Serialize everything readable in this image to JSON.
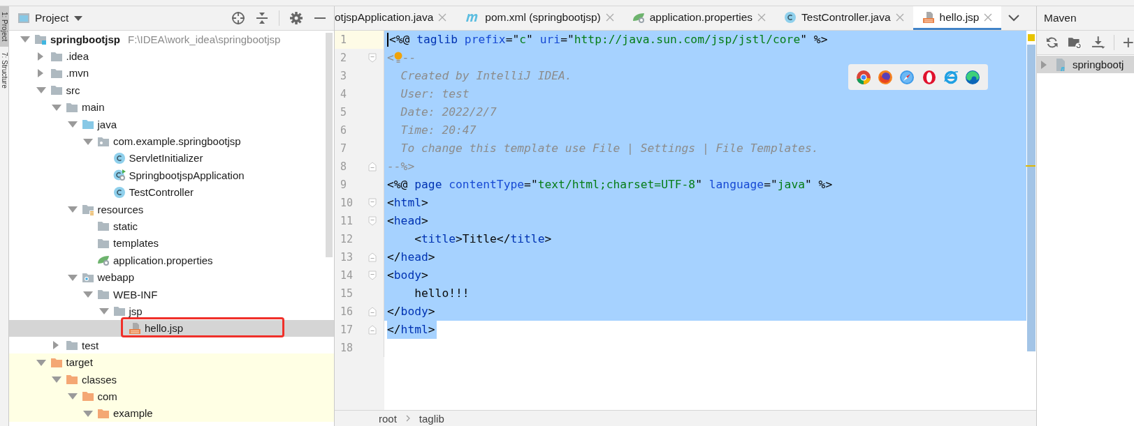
{
  "tool_strip": [
    {
      "label": "1: Project",
      "selected": true
    },
    {
      "label": "7: Structure",
      "selected": false
    }
  ],
  "project_panel": {
    "title": "Project",
    "tree": [
      {
        "label": "springbootjsp",
        "path": "F:\\IDEA\\work_idea\\springbootjsp",
        "kind": "module",
        "expanded": true,
        "selected": false,
        "excluded": false,
        "children": [
          {
            "label": ".idea",
            "kind": "folder",
            "expanded": false,
            "selected": false,
            "excluded": false
          },
          {
            "label": ".mvn",
            "kind": "folder",
            "expanded": false,
            "selected": false,
            "excluded": false
          },
          {
            "label": "src",
            "kind": "folder",
            "expanded": true,
            "selected": false,
            "excluded": false,
            "children": [
              {
                "label": "main",
                "kind": "folder",
                "expanded": true,
                "selected": false,
                "excluded": false,
                "children": [
                  {
                    "label": "java",
                    "kind": "source",
                    "expanded": true,
                    "selected": false,
                    "excluded": false,
                    "children": [
                      {
                        "label": "com.example.springbootjsp",
                        "kind": "package",
                        "expanded": true,
                        "selected": false,
                        "excluded": false,
                        "children": [
                          {
                            "label": "ServletInitializer",
                            "kind": "class",
                            "selected": false,
                            "excluded": false
                          },
                          {
                            "label": "SpringbootjspApplication",
                            "kind": "spring-class",
                            "selected": false,
                            "excluded": false
                          },
                          {
                            "label": "TestController",
                            "kind": "class",
                            "selected": false,
                            "excluded": false
                          }
                        ]
                      }
                    ]
                  },
                  {
                    "label": "resources",
                    "kind": "resources",
                    "expanded": true,
                    "selected": false,
                    "excluded": false,
                    "children": [
                      {
                        "label": "static",
                        "kind": "folder",
                        "selected": false,
                        "excluded": false
                      },
                      {
                        "label": "templates",
                        "kind": "folder",
                        "selected": false,
                        "excluded": false
                      },
                      {
                        "label": "application.properties",
                        "kind": "properties",
                        "selected": false,
                        "excluded": false
                      }
                    ]
                  },
                  {
                    "label": "webapp",
                    "kind": "webapp",
                    "expanded": true,
                    "selected": false,
                    "excluded": false,
                    "children": [
                      {
                        "label": "WEB-INF",
                        "kind": "folder",
                        "expanded": true,
                        "selected": false,
                        "excluded": false,
                        "children": [
                          {
                            "label": "jsp",
                            "kind": "folder",
                            "expanded": true,
                            "selected": false,
                            "excluded": false,
                            "children": [
                              {
                                "label": "hello.jsp",
                                "kind": "jsp",
                                "selected": true,
                                "highlighted": true
                              }
                            ]
                          }
                        ]
                      }
                    ]
                  }
                ]
              },
              {
                "label": "test",
                "kind": "folder",
                "expanded": false,
                "selected": false,
                "excluded": false
              }
            ]
          },
          {
            "label": "target",
            "kind": "folder",
            "expanded": true,
            "selected": false,
            "excluded": true,
            "children": [
              {
                "label": "classes",
                "kind": "folder",
                "expanded": true,
                "selected": false,
                "excluded": true,
                "children": [
                  {
                    "label": "com",
                    "kind": "folder",
                    "expanded": true,
                    "selected": false,
                    "excluded": true,
                    "children": [
                      {
                        "label": "example",
                        "kind": "folder",
                        "expanded": true,
                        "selected": false,
                        "excluded": true
                      }
                    ]
                  }
                ]
              }
            ]
          }
        ]
      }
    ]
  },
  "editor": {
    "tabs": [
      {
        "label": "otjspApplication.java",
        "selected": false
      },
      {
        "label": "pom.xml (springbootjsp)",
        "kind": "pom",
        "selected": false
      },
      {
        "label": "application.properties",
        "kind": "properties",
        "selected": false
      },
      {
        "label": "TestController.java",
        "kind": "class",
        "selected": false
      },
      {
        "label": "hello.jsp",
        "kind": "jsp",
        "selected": true
      }
    ],
    "lines": [
      {
        "number": "1",
        "current": true,
        "selected": true,
        "selection_to_end": true,
        "tokens": [
          {
            "text": "<%@ ",
            "kind": "plain"
          },
          {
            "text": "taglib",
            "kind": "keyword"
          },
          {
            "text": " prefix",
            "kind": "attr"
          },
          {
            "text": "=\"",
            "kind": "plain"
          },
          {
            "text": "c",
            "kind": "string"
          },
          {
            "text": "\"",
            "kind": "plain"
          },
          {
            "text": " uri",
            "kind": "attr"
          },
          {
            "text": "=\"",
            "kind": "plain"
          },
          {
            "text": "http://java.sun.com/jsp/jstl/core",
            "kind": "string"
          },
          {
            "text": "\" %>",
            "kind": "plain"
          }
        ]
      },
      {
        "number": "2",
        "current": false,
        "selected": true,
        "selection_to_end": true,
        "fold_start": true,
        "bulb": true,
        "tokens": [
          {
            "text": "<",
            "kind": "comment"
          },
          {
            "text": "--",
            "kind": "comment"
          }
        ]
      },
      {
        "number": "3",
        "current": false,
        "selected": true,
        "selection_to_end": true,
        "tokens": [
          {
            "text": "  Created by IntelliJ IDEA.",
            "kind": "comment"
          }
        ]
      },
      {
        "number": "4",
        "current": false,
        "selected": true,
        "selection_to_end": true,
        "tokens": [
          {
            "text": "  User: test",
            "kind": "comment"
          }
        ]
      },
      {
        "number": "5",
        "current": false,
        "selected": true,
        "selection_to_end": true,
        "tokens": [
          {
            "text": "  Date: 2022/2/7",
            "kind": "comment"
          }
        ]
      },
      {
        "number": "6",
        "current": false,
        "selected": true,
        "selection_to_end": true,
        "tokens": [
          {
            "text": "  Time: 20:47",
            "kind": "comment"
          }
        ]
      },
      {
        "number": "7",
        "current": false,
        "selected": true,
        "selection_to_end": true,
        "tokens": [
          {
            "text": "  To change this template use File | Settings | File Templates.",
            "kind": "comment"
          }
        ]
      },
      {
        "number": "8",
        "current": false,
        "selected": true,
        "selection_to_end": true,
        "fold_end": true,
        "tokens": [
          {
            "text": "--%>",
            "kind": "comment"
          }
        ]
      },
      {
        "number": "9",
        "current": false,
        "selected": true,
        "selection_to_end": true,
        "tokens": [
          {
            "text": "<%@ ",
            "kind": "plain"
          },
          {
            "text": "page",
            "kind": "keyword"
          },
          {
            "text": " contentType",
            "kind": "attr"
          },
          {
            "text": "=\"",
            "kind": "plain"
          },
          {
            "text": "text/html;charset=UTF-8",
            "kind": "string"
          },
          {
            "text": "\"",
            "kind": "plain"
          },
          {
            "text": " language",
            "kind": "attr"
          },
          {
            "text": "=\"",
            "kind": "plain"
          },
          {
            "text": "java",
            "kind": "string"
          },
          {
            "text": "\" %>",
            "kind": "plain"
          }
        ]
      },
      {
        "number": "10",
        "current": false,
        "selected": true,
        "selection_to_end": true,
        "fold_start": true,
        "tokens": [
          {
            "text": "<",
            "kind": "plain"
          },
          {
            "text": "html",
            "kind": "keyword"
          },
          {
            "text": ">",
            "kind": "plain"
          }
        ]
      },
      {
        "number": "11",
        "current": false,
        "selected": true,
        "selection_to_end": true,
        "fold_start": true,
        "tokens": [
          {
            "text": "<",
            "kind": "plain"
          },
          {
            "text": "head",
            "kind": "keyword"
          },
          {
            "text": ">",
            "kind": "plain"
          }
        ]
      },
      {
        "number": "12",
        "current": false,
        "selected": true,
        "selection_to_end": true,
        "tokens": [
          {
            "text": "    <",
            "kind": "plain"
          },
          {
            "text": "title",
            "kind": "keyword"
          },
          {
            "text": ">Title</",
            "kind": "plain"
          },
          {
            "text": "title",
            "kind": "keyword"
          },
          {
            "text": ">",
            "kind": "plain"
          }
        ]
      },
      {
        "number": "13",
        "current": false,
        "selected": true,
        "selection_to_end": true,
        "fold_end": true,
        "tokens": [
          {
            "text": "</",
            "kind": "plain"
          },
          {
            "text": "head",
            "kind": "keyword"
          },
          {
            "text": ">",
            "kind": "plain"
          }
        ]
      },
      {
        "number": "14",
        "current": false,
        "selected": true,
        "selection_to_end": true,
        "fold_start": true,
        "tokens": [
          {
            "text": "<",
            "kind": "plain"
          },
          {
            "text": "body",
            "kind": "keyword"
          },
          {
            "text": ">",
            "kind": "plain"
          }
        ]
      },
      {
        "number": "15",
        "current": false,
        "selected": true,
        "selection_to_end": true,
        "tokens": [
          {
            "text": "    hello!!!",
            "kind": "plain"
          }
        ]
      },
      {
        "number": "16",
        "current": false,
        "selected": true,
        "selection_to_end": true,
        "fold_end": true,
        "tokens": [
          {
            "text": "</",
            "kind": "plain"
          },
          {
            "text": "body",
            "kind": "keyword"
          },
          {
            "text": ">",
            "kind": "plain"
          }
        ]
      },
      {
        "number": "17",
        "current": false,
        "selected": true,
        "selection_to_end": false,
        "fold_end": true,
        "tokens": [
          {
            "text": "</",
            "kind": "plain"
          },
          {
            "text": "html",
            "kind": "keyword"
          },
          {
            "text": ">",
            "kind": "plain"
          }
        ]
      },
      {
        "number": "18",
        "current": false
      }
    ],
    "breadcrumbs": [
      "root",
      "taglib"
    ]
  },
  "maven_panel": {
    "title": "Maven",
    "tree": [
      {
        "label": "springbootj",
        "expanded": false,
        "selected": true
      }
    ]
  }
}
